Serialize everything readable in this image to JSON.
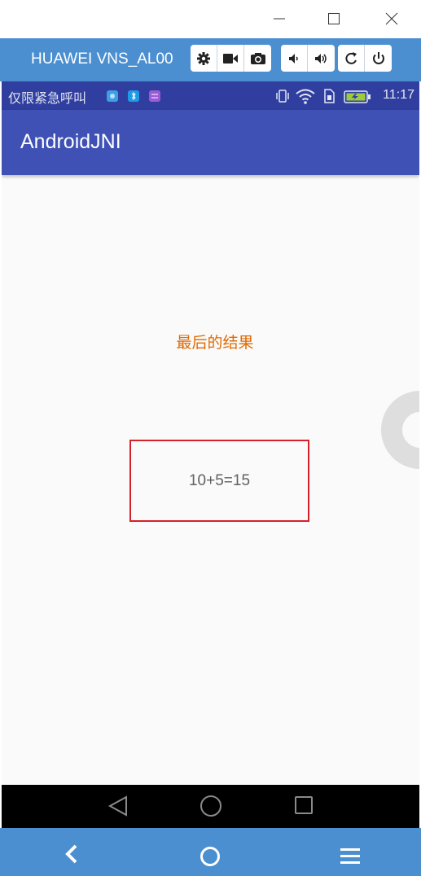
{
  "window": {
    "controls": [
      {
        "name": "minimize-icon",
        "icon": "minimize-icon"
      },
      {
        "name": "maximize-icon",
        "icon": "maximize-icon"
      },
      {
        "name": "close-icon",
        "icon": "close-icon"
      }
    ]
  },
  "emulator": {
    "device_name": "HUAWEI VNS_AL00",
    "toolbar_groups": [
      [
        "gear-icon",
        "video-camera-icon",
        "camera-icon"
      ],
      [
        "volume-down-icon",
        "volume-up-icon"
      ],
      [
        "rotate-icon",
        "power-icon"
      ]
    ],
    "bottom_nav": [
      "back-chevron-icon",
      "home-circle-icon",
      "menu-icon"
    ],
    "accent_color": "#4b8fd0"
  },
  "status_bar": {
    "carrier_text": "仅限紧急呼叫",
    "time": "11:17",
    "notification_icons": [
      "app-icon",
      "bluetooth-icon",
      "message-icon"
    ],
    "system_icons": [
      "vibrate-icon",
      "wifi-icon",
      "sim-icon",
      "battery-icon"
    ],
    "color": "#303f9f"
  },
  "app": {
    "title": "AndroidJNI",
    "primary_color": "#3f51b5",
    "result_label": "最后的结果",
    "result_value": "10+5=15"
  },
  "android_nav": [
    "back-triangle-icon",
    "home-circle-icon",
    "recents-square-icon"
  ]
}
